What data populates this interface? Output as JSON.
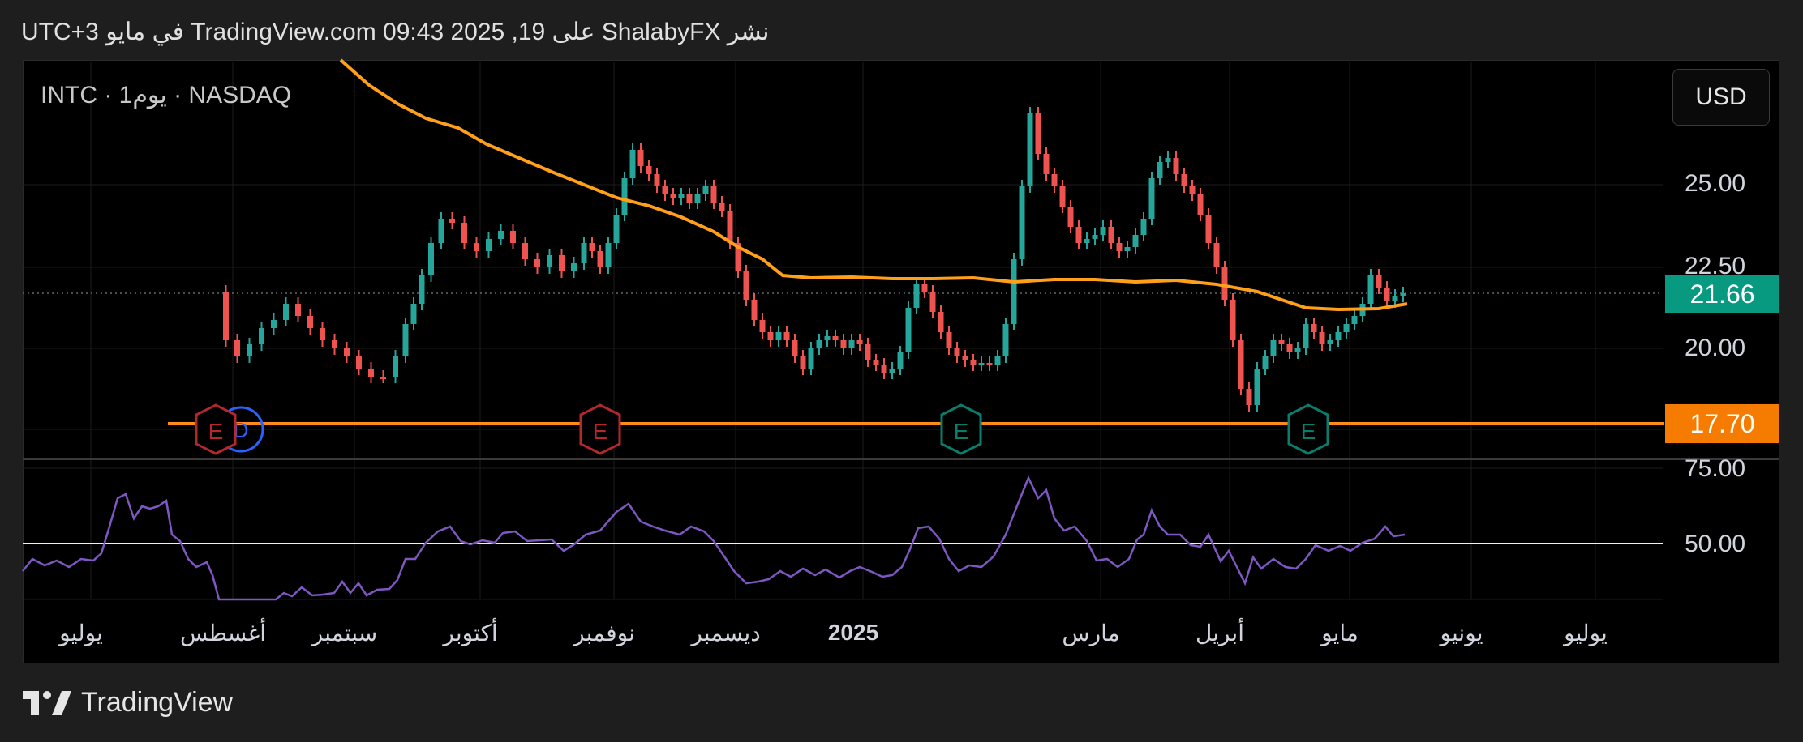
{
  "header": {
    "published_text": "نشر ShalabyFX على TradingView.com 09:43 2025 ,19 في مايو UTC+3"
  },
  "chart": {
    "symbol_label": "INTC · 1يوم · NASDAQ",
    "currency_button": "USD",
    "price_ticks": [
      "25.00",
      "22.50",
      "20.00",
      "75.00",
      "50.00"
    ],
    "current_price_badge": "21.66",
    "level_badge": "17.70",
    "colors": {
      "up_candle": "#26a69a",
      "down_candle": "#ef5350",
      "moving_average": "#ff9f1a",
      "support_line": "#ff8c1a",
      "rsi_line": "#7e57c2",
      "current_badge": "#089981",
      "level_badge": "#f57c00",
      "earnings_red": "#b2282d",
      "earnings_green": "#0a7d6d"
    },
    "earnings_markers": [
      {
        "label": "E",
        "style": "red"
      },
      {
        "label": "E",
        "style": "red"
      },
      {
        "label": "E",
        "style": "green"
      },
      {
        "label": "E",
        "style": "green"
      }
    ],
    "dividend_marker": {
      "label": "D"
    }
  },
  "time_axis": {
    "labels": [
      "يوليو",
      "أغسطس",
      "سبتمبر",
      "أكتوبر",
      "نوفمبر",
      "ديسمبر",
      "2025",
      "مارس",
      "أبريل",
      "مايو",
      "يونيو",
      "يوليو"
    ]
  },
  "footer": {
    "brand": "TradingView"
  }
}
